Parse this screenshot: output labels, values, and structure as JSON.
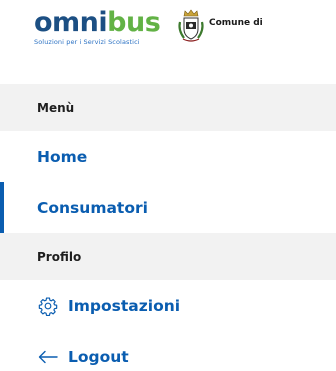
{
  "header": {
    "brand_name_a": "omni",
    "brand_name_b": "bus",
    "brand_tagline": "Soluzioni per i Servizi Scolastici",
    "municipality_label": "Comune di"
  },
  "menu": {
    "sections": [
      {
        "title": "Menù",
        "items": [
          {
            "label": "Home",
            "active": false
          },
          {
            "label": "Consumatori",
            "active": true
          }
        ]
      },
      {
        "title": "Profilo",
        "items": [
          {
            "label": "Impostazioni",
            "icon": "gear-icon"
          },
          {
            "label": "Logout",
            "icon": "arrow-left-icon"
          }
        ]
      }
    ]
  },
  "colors": {
    "primary": "#0a5db0",
    "brand_dark_blue": "#1c4f83",
    "brand_green": "#62b245",
    "section_bg": "#f2f2f2"
  }
}
